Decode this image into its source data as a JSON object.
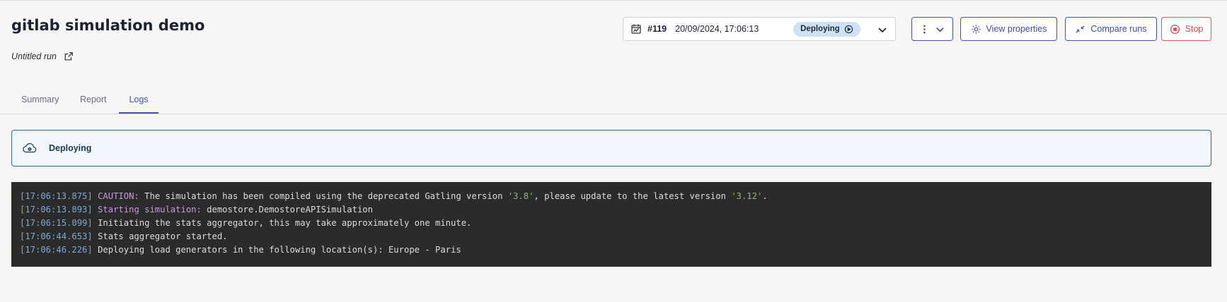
{
  "header": {
    "title": "gitlab simulation demo",
    "run_name": "Untitled run"
  },
  "run_selector": {
    "number": "#119",
    "datetime": "20/09/2024, 17:06:13",
    "status": "Deploying"
  },
  "toolbar": {
    "view_properties": "View properties",
    "compare_runs": "Compare runs",
    "stop": "Stop"
  },
  "tabs": [
    {
      "label": "Summary",
      "active": false
    },
    {
      "label": "Report",
      "active": false
    },
    {
      "label": "Logs",
      "active": true
    }
  ],
  "alert": {
    "label": "Deploying"
  },
  "logs": [
    {
      "ts": "[17:06:13.875]",
      "prefix": "CAUTION:",
      "text1": " The simulation has been compiled using the deprecated Gatling version ",
      "s1": "'3.8'",
      "text2": ", please update to the latest version ",
      "s2": "'3.12'",
      "text3": "."
    },
    {
      "ts": "[17:06:13.893]",
      "prefix": "Starting simulation:",
      "text1": " demostore.DemostoreAPISimulation"
    },
    {
      "ts": "[17:06:15.099]",
      "text1": " Initiating the stats aggregator, this may take approximately one minute."
    },
    {
      "ts": "[17:06:44.653]",
      "text1": " Stats aggregator started."
    },
    {
      "ts": "[17:06:46.226]",
      "text1": " Deploying load generators in the following location(s): Europe - Paris"
    }
  ],
  "colors": {
    "accent": "#4451b8",
    "stop": "#d94a4a",
    "badge_bg": "#cde3f5",
    "alert_border": "#2b67a0",
    "console_bg": "#2b2b2b"
  },
  "icons": {
    "edit": "external-edit-icon",
    "calendar": "calendar-icon",
    "status": "play-circle-icon",
    "dropdown": "chevron-down-icon",
    "more": "kebab-menu-icon",
    "view": "gear-icon",
    "compare": "compare-icon",
    "stop": "stop-circle-icon",
    "alert": "cloud-gear-icon"
  }
}
